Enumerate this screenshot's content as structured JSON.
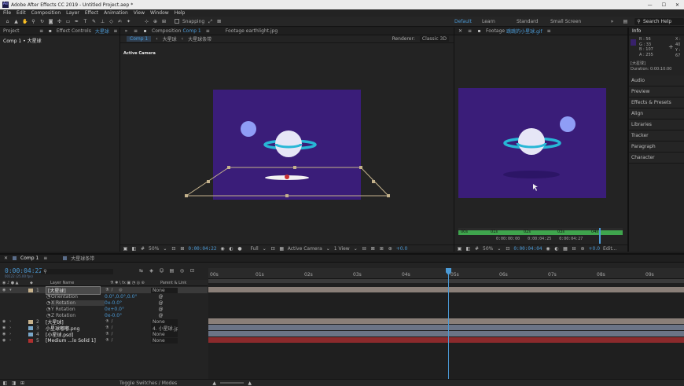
{
  "window": {
    "title": "Adobe After Effects CC 2019 - Untitled Project.aep *",
    "controls": [
      "—",
      "☐",
      "✕"
    ]
  },
  "menu": [
    "File",
    "Edit",
    "Composition",
    "Layer",
    "Effect",
    "Animation",
    "View",
    "Window",
    "Help"
  ],
  "toolbar": {
    "snapping": "Snapping",
    "workspaces": [
      "Default",
      "Learn",
      "Standard",
      "Small Screen"
    ],
    "search_placeholder": "Search Help"
  },
  "left_panel": {
    "tab1": "Project",
    "tab2": "Effect Controls",
    "tab2_target": "大星球",
    "breadcrumb": "Comp 1 • 大星球"
  },
  "comp_panel": {
    "tab": "Composition",
    "tab_target": "Comp 1",
    "tab_footage": "Footage earthlight.jpg",
    "crumbs": [
      "Comp 1",
      "大星球",
      "大星球条带"
    ],
    "renderer_label": "Renderer:",
    "renderer": "Classic 3D",
    "active_camera": "Active Camera",
    "footer": {
      "zoom": "50%",
      "time": "0:00:04:22",
      "quality": "Full",
      "view": "Active Camera",
      "views": "1 View",
      "exposure": "+0.0"
    }
  },
  "footage_panel": {
    "tab": "Footage",
    "tab_target": "跳跳的小星球.gif",
    "ruler": [
      "00s",
      "01s",
      "02s",
      "03s",
      "04s"
    ],
    "time_in": "0:00:00:00",
    "time_cur": "0:00:04:25",
    "time_dur": "0:00:04:27",
    "footer": {
      "zoom": "50%",
      "time": "0:00:04:04",
      "exposure": "+0.0",
      "edit": "Edit..."
    }
  },
  "info_panel": {
    "title": "Info",
    "rgb": [
      "R : 56",
      "G : 33",
      "B : 107",
      "A : 255"
    ],
    "xy": [
      "X : 40",
      "Y : 67"
    ],
    "layer_label": "[大星球]",
    "duration": "Duration: 0:00:10:00",
    "colors": {
      "swatch": "#38216b"
    }
  },
  "side_panels": [
    "Audio",
    "Preview",
    "Effects & Presets",
    "Align",
    "Libraries",
    "Tracker",
    "Paragraph",
    "Character"
  ],
  "timeline": {
    "tabs": [
      "Comp 1",
      "大星球条带"
    ],
    "timecode": "0:00:04:22",
    "fps_note": "00122 (25.00 fps)",
    "columns": {
      "layer_name": "Layer Name",
      "parent": "Parent & Link"
    },
    "ruler": [
      "00s",
      "01s",
      "02s",
      "03s",
      "04s",
      "05s",
      "06s",
      "07s",
      "08s",
      "09s"
    ],
    "layers": [
      {
        "num": "1",
        "name": "[大星球]",
        "parent": "None",
        "color": "#c7b28c",
        "selected": true
      },
      {
        "num": "2",
        "name": "[大星球]",
        "parent": "None",
        "color": "#c7b28c"
      },
      {
        "num": "3",
        "name": "小星球嘟嘟.png",
        "parent": "4. 小星球.jp",
        "color": "#7aa7c8"
      },
      {
        "num": "4",
        "name": "[小星球.psd]",
        "parent": "None",
        "color": "#7aa7c8"
      },
      {
        "num": "5",
        "name": "[Medium ...lo Solid 1]",
        "parent": "None",
        "color": "#b0302f"
      }
    ],
    "props": [
      {
        "name": "Orientation",
        "value": "0.0°,0.0°,0.0°"
      },
      {
        "name": "X Rotation",
        "value": "0x-0.0°",
        "highlight": true
      },
      {
        "name": "Y Rotation",
        "value": "0x+0.0°"
      },
      {
        "name": "Z Rotation",
        "value": "0x-0.0°"
      }
    ],
    "footer": "Toggle Switches / Modes",
    "colors": {
      "track_main": "#8a7f78",
      "track_solid": "#8b2a2c",
      "playhead": "#4b9ad6"
    }
  }
}
